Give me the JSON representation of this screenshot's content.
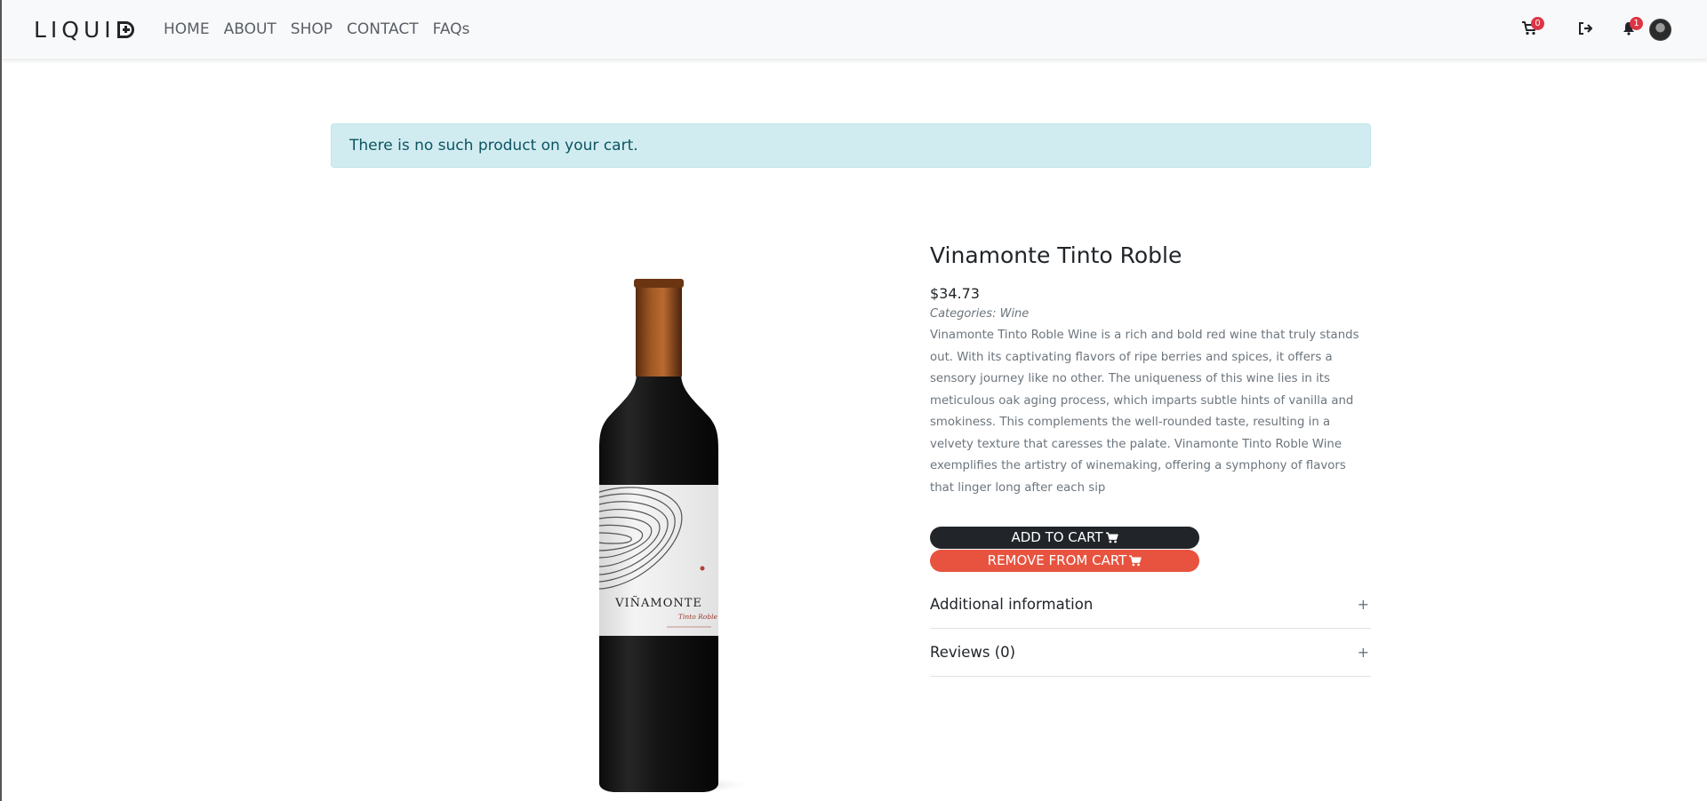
{
  "brand": {
    "logo_text": "LIQUI"
  },
  "nav": {
    "links": [
      "HOME",
      "ABOUT",
      "SHOP",
      "CONTACT",
      "FAQs"
    ]
  },
  "header_icons": {
    "cart": {
      "icon": "cart-icon",
      "count": "0"
    },
    "logout": {
      "icon": "sign-out-icon"
    },
    "notifications": {
      "icon": "bell-icon",
      "count": "1"
    },
    "profile": {
      "icon": "avatar"
    }
  },
  "alert": {
    "message": "There is no such product on your cart."
  },
  "product": {
    "title": "Vinamonte Tinto Roble",
    "price": "$34.73",
    "categories": "Categories: Wine",
    "description": "Vinamonte Tinto Roble Wine is a rich and bold red wine that truly stands out. With its captivating flavors of ripe berries and spices, it offers a sensory journey like no other. The uniqueness of this wine lies in its meticulous oak aging process, which imparts subtle hints of vanilla and smokiness. This complements the well-rounded taste, resulting in a velvety texture that caresses the palate. Vinamonte Tinto Roble Wine exemplifies the artistry of winemaking, offering a symphony of flavors that linger long after each sip",
    "label_brand": "VIÑAMONTE",
    "label_sub": "Tinto Roble"
  },
  "actions": {
    "add_to_cart": "ADD TO CART",
    "remove_from_cart": "REMOVE FROM CART"
  },
  "accordion": [
    {
      "title": "Additional information",
      "icon": "+"
    },
    {
      "title": "Reviews (0)",
      "icon": "+"
    }
  ],
  "colors": {
    "navbar_bg": "#f8f9fa",
    "alert_bg": "#d1ecf1",
    "alert_text": "#0c5460",
    "add_btn": "#212529",
    "remove_btn": "#e8533f",
    "badge": "#dc3545"
  }
}
